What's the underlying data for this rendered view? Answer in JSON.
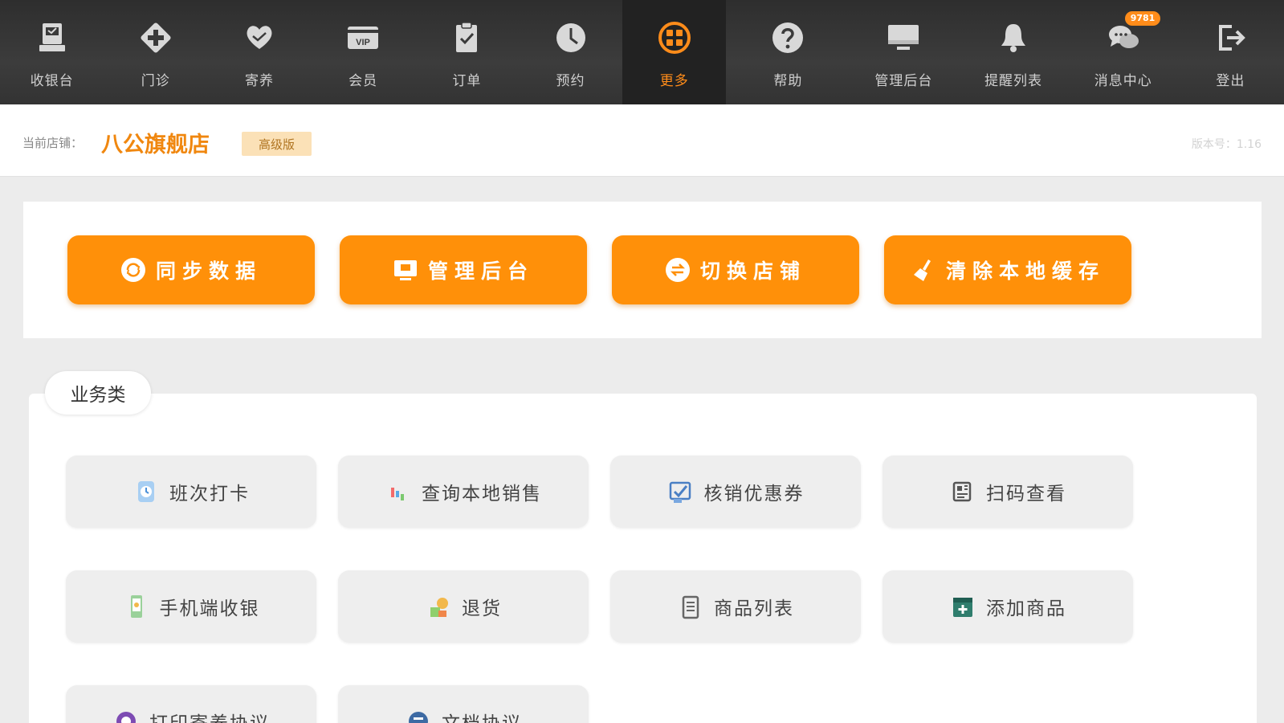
{
  "nav": {
    "items": [
      {
        "label": "收银台",
        "icon": "cashier-icon"
      },
      {
        "label": "门诊",
        "icon": "clinic-cross-icon"
      },
      {
        "label": "寄养",
        "icon": "heart-hand-icon"
      },
      {
        "label": "会员",
        "icon": "vip-card-icon"
      },
      {
        "label": "订单",
        "icon": "clipboard-check-icon"
      },
      {
        "label": "预约",
        "icon": "clock-icon"
      },
      {
        "label": "更多",
        "icon": "grid-circle-icon",
        "active": true
      },
      {
        "label": "帮助",
        "icon": "help-icon"
      },
      {
        "label": "管理后台",
        "icon": "monitor-icon"
      },
      {
        "label": "提醒列表",
        "icon": "bell-icon"
      },
      {
        "label": "消息中心",
        "icon": "chat-icon",
        "badge": "9781"
      },
      {
        "label": "登出",
        "icon": "logout-icon"
      }
    ]
  },
  "store": {
    "label": "当前店铺：",
    "name": "八公旗舰店",
    "tier": "高级版",
    "version": "版本号：1.16"
  },
  "actions": [
    {
      "label": "同步数据",
      "icon": "sync-icon"
    },
    {
      "label": "管理后台",
      "icon": "admin-monitor-icon"
    },
    {
      "label": "切换店铺",
      "icon": "switch-store-icon"
    },
    {
      "label": "清除本地缓存",
      "icon": "broom-icon"
    }
  ],
  "business": {
    "tab_label": "业务类",
    "items": [
      {
        "label": "班次打卡",
        "icon": "clock-in-icon"
      },
      {
        "label": "查询本地销售",
        "icon": "sales-chart-icon"
      },
      {
        "label": "核销优惠券",
        "icon": "coupon-check-icon"
      },
      {
        "label": "扫码查看",
        "icon": "scan-code-icon"
      },
      {
        "label": "手机端收银",
        "icon": "mobile-pay-icon"
      },
      {
        "label": "退货",
        "icon": "return-goods-icon"
      },
      {
        "label": "商品列表",
        "icon": "product-list-icon"
      },
      {
        "label": "添加商品",
        "icon": "add-product-icon"
      },
      {
        "label": "打印寄养协议",
        "icon": "print-agreement-icon"
      },
      {
        "label": "文档协议",
        "icon": "document-agreement-icon"
      }
    ]
  },
  "colors": {
    "accent": "#ff9009",
    "nav_bg": "#333333",
    "nav_active_text": "#ff8c1a",
    "store_name": "#f0870f"
  }
}
